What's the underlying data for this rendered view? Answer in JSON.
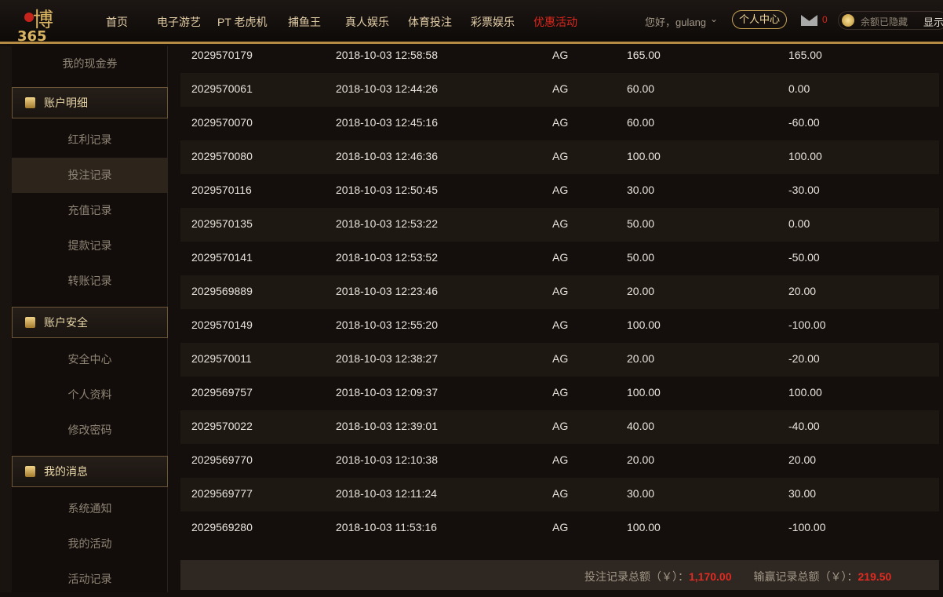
{
  "header": {
    "logo_text": "博365",
    "nav": [
      "首页",
      "电子游艺",
      "PT 老虎机",
      "捕鱼王",
      "真人娱乐",
      "体育投注",
      "彩票娱乐",
      "优惠活动"
    ],
    "greeting": "您好，gulang",
    "user_center": "个人中心",
    "mail_count": "0",
    "balance_hidden": "余额已隐藏",
    "show": "显示",
    "highlight_color": "#e0261c"
  },
  "sidebar": {
    "top_item": "我的现金券",
    "sections": [
      {
        "title": "账户明细",
        "icon": "calculator-icon",
        "items": [
          "红利记录",
          "投注记录",
          "充值记录",
          "提款记录",
          "转账记录"
        ]
      },
      {
        "title": "账户安全",
        "icon": "shield-icon",
        "items": [
          "安全中心",
          "个人资料",
          "修改密码"
        ]
      },
      {
        "title": "我的消息",
        "icon": "chat-icon",
        "items": [
          "系统通知",
          "我的活动",
          "活动记录"
        ]
      }
    ],
    "active": "投注记录"
  },
  "table": {
    "rows": [
      [
        "2029570179",
        "2018-10-03 12:58:58",
        "AG",
        "165.00",
        "165.00"
      ],
      [
        "2029570061",
        "2018-10-03 12:44:26",
        "AG",
        "60.00",
        "0.00"
      ],
      [
        "2029570070",
        "2018-10-03 12:45:16",
        "AG",
        "60.00",
        "-60.00"
      ],
      [
        "2029570080",
        "2018-10-03 12:46:36",
        "AG",
        "100.00",
        "100.00"
      ],
      [
        "2029570116",
        "2018-10-03 12:50:45",
        "AG",
        "30.00",
        "-30.00"
      ],
      [
        "2029570135",
        "2018-10-03 12:53:22",
        "AG",
        "50.00",
        "0.00"
      ],
      [
        "2029570141",
        "2018-10-03 12:53:52",
        "AG",
        "50.00",
        "-50.00"
      ],
      [
        "2029569889",
        "2018-10-03 12:23:46",
        "AG",
        "20.00",
        "20.00"
      ],
      [
        "2029570149",
        "2018-10-03 12:55:20",
        "AG",
        "100.00",
        "-100.00"
      ],
      [
        "2029570011",
        "2018-10-03 12:38:27",
        "AG",
        "20.00",
        "-20.00"
      ],
      [
        "2029569757",
        "2018-10-03 12:09:37",
        "AG",
        "100.00",
        "100.00"
      ],
      [
        "2029570022",
        "2018-10-03 12:39:01",
        "AG",
        "40.00",
        "-40.00"
      ],
      [
        "2029569770",
        "2018-10-03 12:10:38",
        "AG",
        "20.00",
        "20.00"
      ],
      [
        "2029569777",
        "2018-10-03 12:11:24",
        "AG",
        "30.00",
        "30.00"
      ],
      [
        "2029569280",
        "2018-10-03 11:53:16",
        "AG",
        "100.00",
        "-100.00"
      ]
    ]
  },
  "summary": {
    "bet_label": "投注记录总额（￥）：",
    "bet_total": "1,170.00",
    "win_label": "输赢记录总额（￥）：",
    "win_total": "219.50"
  }
}
